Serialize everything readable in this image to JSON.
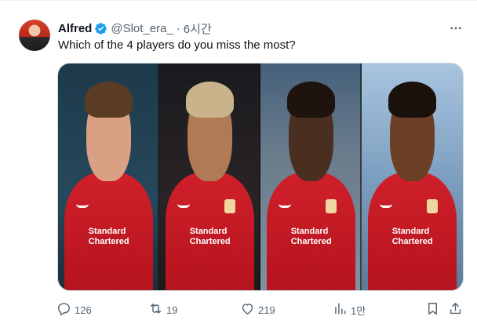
{
  "tweet": {
    "author_name": "Alfred",
    "handle": "@Slot_era_",
    "separator": "·",
    "time": "6시간",
    "text": "Which of the 4 players do you miss the most?",
    "media": {
      "players": [
        {
          "sponsor": "Standard Chartered"
        },
        {
          "sponsor": "Standard Chartered"
        },
        {
          "sponsor": "Standard Chartered"
        },
        {
          "sponsor": "Standard Chartered"
        }
      ]
    },
    "actions": {
      "replies": "126",
      "reposts": "19",
      "likes": "219",
      "views": "1만"
    }
  },
  "colors": {
    "verified": "#1d9bf0",
    "secondary_text": "#536471",
    "shirt_red": "#c8102e"
  },
  "icons": {
    "more": "more-icon",
    "verified": "verified-badge-icon",
    "reply": "reply-icon",
    "repost": "repost-icon",
    "like": "heart-icon",
    "views": "views-icon",
    "bookmark": "bookmark-icon",
    "share": "share-icon"
  }
}
